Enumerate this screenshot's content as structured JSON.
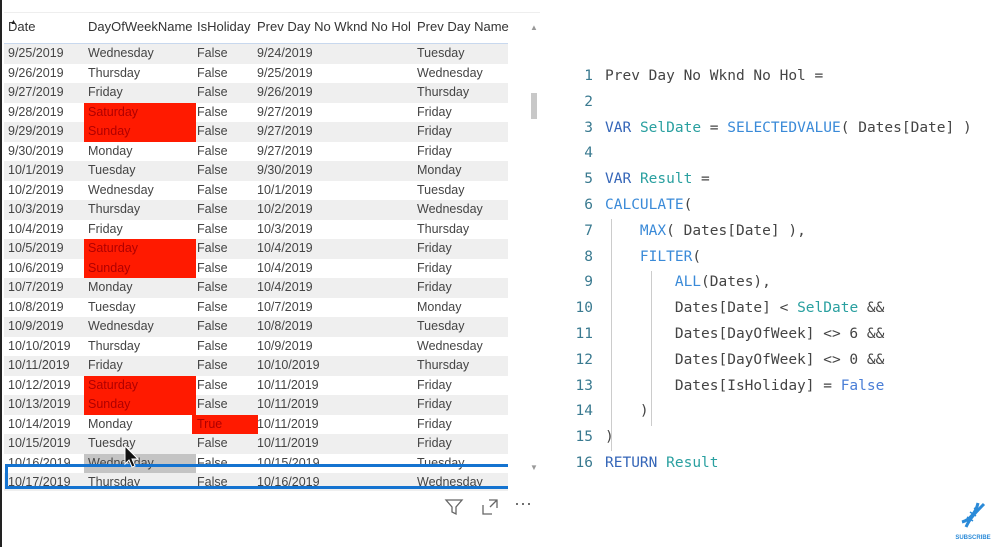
{
  "table": {
    "columns": [
      "Date",
      "DayOfWeekName",
      "IsHoliday",
      "Prev Day No Wknd No Hol",
      "Prev Day Name"
    ],
    "rows": [
      [
        "9/25/2019",
        "Wednesday",
        "False",
        "9/24/2019",
        "Tuesday"
      ],
      [
        "9/26/2019",
        "Thursday",
        "False",
        "9/25/2019",
        "Wednesday"
      ],
      [
        "9/27/2019",
        "Friday",
        "False",
        "9/26/2019",
        "Thursday"
      ],
      [
        "9/28/2019",
        "Saturday",
        "False",
        "9/27/2019",
        "Friday"
      ],
      [
        "9/29/2019",
        "Sunday",
        "False",
        "9/27/2019",
        "Friday"
      ],
      [
        "9/30/2019",
        "Monday",
        "False",
        "9/27/2019",
        "Friday"
      ],
      [
        "10/1/2019",
        "Tuesday",
        "False",
        "9/30/2019",
        "Monday"
      ],
      [
        "10/2/2019",
        "Wednesday",
        "False",
        "10/1/2019",
        "Tuesday"
      ],
      [
        "10/3/2019",
        "Thursday",
        "False",
        "10/2/2019",
        "Wednesday"
      ],
      [
        "10/4/2019",
        "Friday",
        "False",
        "10/3/2019",
        "Thursday"
      ],
      [
        "10/5/2019",
        "Saturday",
        "False",
        "10/4/2019",
        "Friday"
      ],
      [
        "10/6/2019",
        "Sunday",
        "False",
        "10/4/2019",
        "Friday"
      ],
      [
        "10/7/2019",
        "Monday",
        "False",
        "10/4/2019",
        "Friday"
      ],
      [
        "10/8/2019",
        "Tuesday",
        "False",
        "10/7/2019",
        "Monday"
      ],
      [
        "10/9/2019",
        "Wednesday",
        "False",
        "10/8/2019",
        "Tuesday"
      ],
      [
        "10/10/2019",
        "Thursday",
        "False",
        "10/9/2019",
        "Wednesday"
      ],
      [
        "10/11/2019",
        "Friday",
        "False",
        "10/10/2019",
        "Thursday"
      ],
      [
        "10/12/2019",
        "Saturday",
        "False",
        "10/11/2019",
        "Friday"
      ],
      [
        "10/13/2019",
        "Sunday",
        "False",
        "10/11/2019",
        "Friday"
      ],
      [
        "10/14/2019",
        "Monday",
        "True",
        "10/11/2019",
        "Friday"
      ],
      [
        "10/15/2019",
        "Tuesday",
        "False",
        "10/11/2019",
        "Friday"
      ],
      [
        "10/16/2019",
        "Wednesday",
        "False",
        "10/15/2019",
        "Tuesday"
      ],
      [
        "10/17/2019",
        "Thursday",
        "False",
        "10/16/2019",
        "Wednesday"
      ]
    ],
    "selected_row": "10/15/2019",
    "highlight_color": "#ff1a00",
    "selection_color": "#1473d0",
    "sort": "Date ascending"
  },
  "toolbar": {
    "icons": [
      "filter-icon",
      "focus-mode-icon",
      "more-options-icon"
    ],
    "more": "⋯"
  },
  "code": {
    "lines": [
      [
        [
          "Prev Day No Wknd No Hol =",
          ""
        ]
      ],
      [],
      [
        [
          "VAR",
          "kw"
        ],
        [
          " ",
          ""
        ],
        [
          "SelDate",
          "var"
        ],
        [
          " = ",
          ""
        ],
        [
          "SELECTEDVALUE",
          "fn"
        ],
        [
          "( Dates[Date] )",
          ""
        ]
      ],
      [],
      [
        [
          "VAR",
          "kw"
        ],
        [
          " ",
          ""
        ],
        [
          "Result",
          "var"
        ],
        [
          " =",
          ""
        ]
      ],
      [
        [
          "CALCULATE",
          "fn"
        ],
        [
          "(",
          ""
        ]
      ],
      [
        [
          "    ",
          ""
        ],
        [
          "MAX",
          "fn"
        ],
        [
          "( Dates[Date] ),",
          ""
        ]
      ],
      [
        [
          "    ",
          ""
        ],
        [
          "FILTER",
          "fn"
        ],
        [
          "(",
          ""
        ]
      ],
      [
        [
          "        ",
          ""
        ],
        [
          "ALL",
          "fn"
        ],
        [
          "(Dates),",
          ""
        ]
      ],
      [
        [
          "        Dates[Date] < ",
          ""
        ],
        [
          "SelDate",
          "var"
        ],
        [
          " &&",
          ""
        ]
      ],
      [
        [
          "        Dates[DayOfWeek] <> 6 &&",
          ""
        ]
      ],
      [
        [
          "        Dates[DayOfWeek] <> 0 &&",
          ""
        ]
      ],
      [
        [
          "        Dates[IsHoliday] = ",
          ""
        ],
        [
          "False",
          "bool"
        ]
      ],
      [
        [
          "    )",
          ""
        ]
      ],
      [
        [
          ")",
          ""
        ]
      ],
      [
        [
          "RETURN",
          "kw"
        ],
        [
          " ",
          ""
        ],
        [
          "Result",
          "var"
        ]
      ]
    ]
  },
  "logo": {
    "text": "SUBSCRIBE"
  }
}
